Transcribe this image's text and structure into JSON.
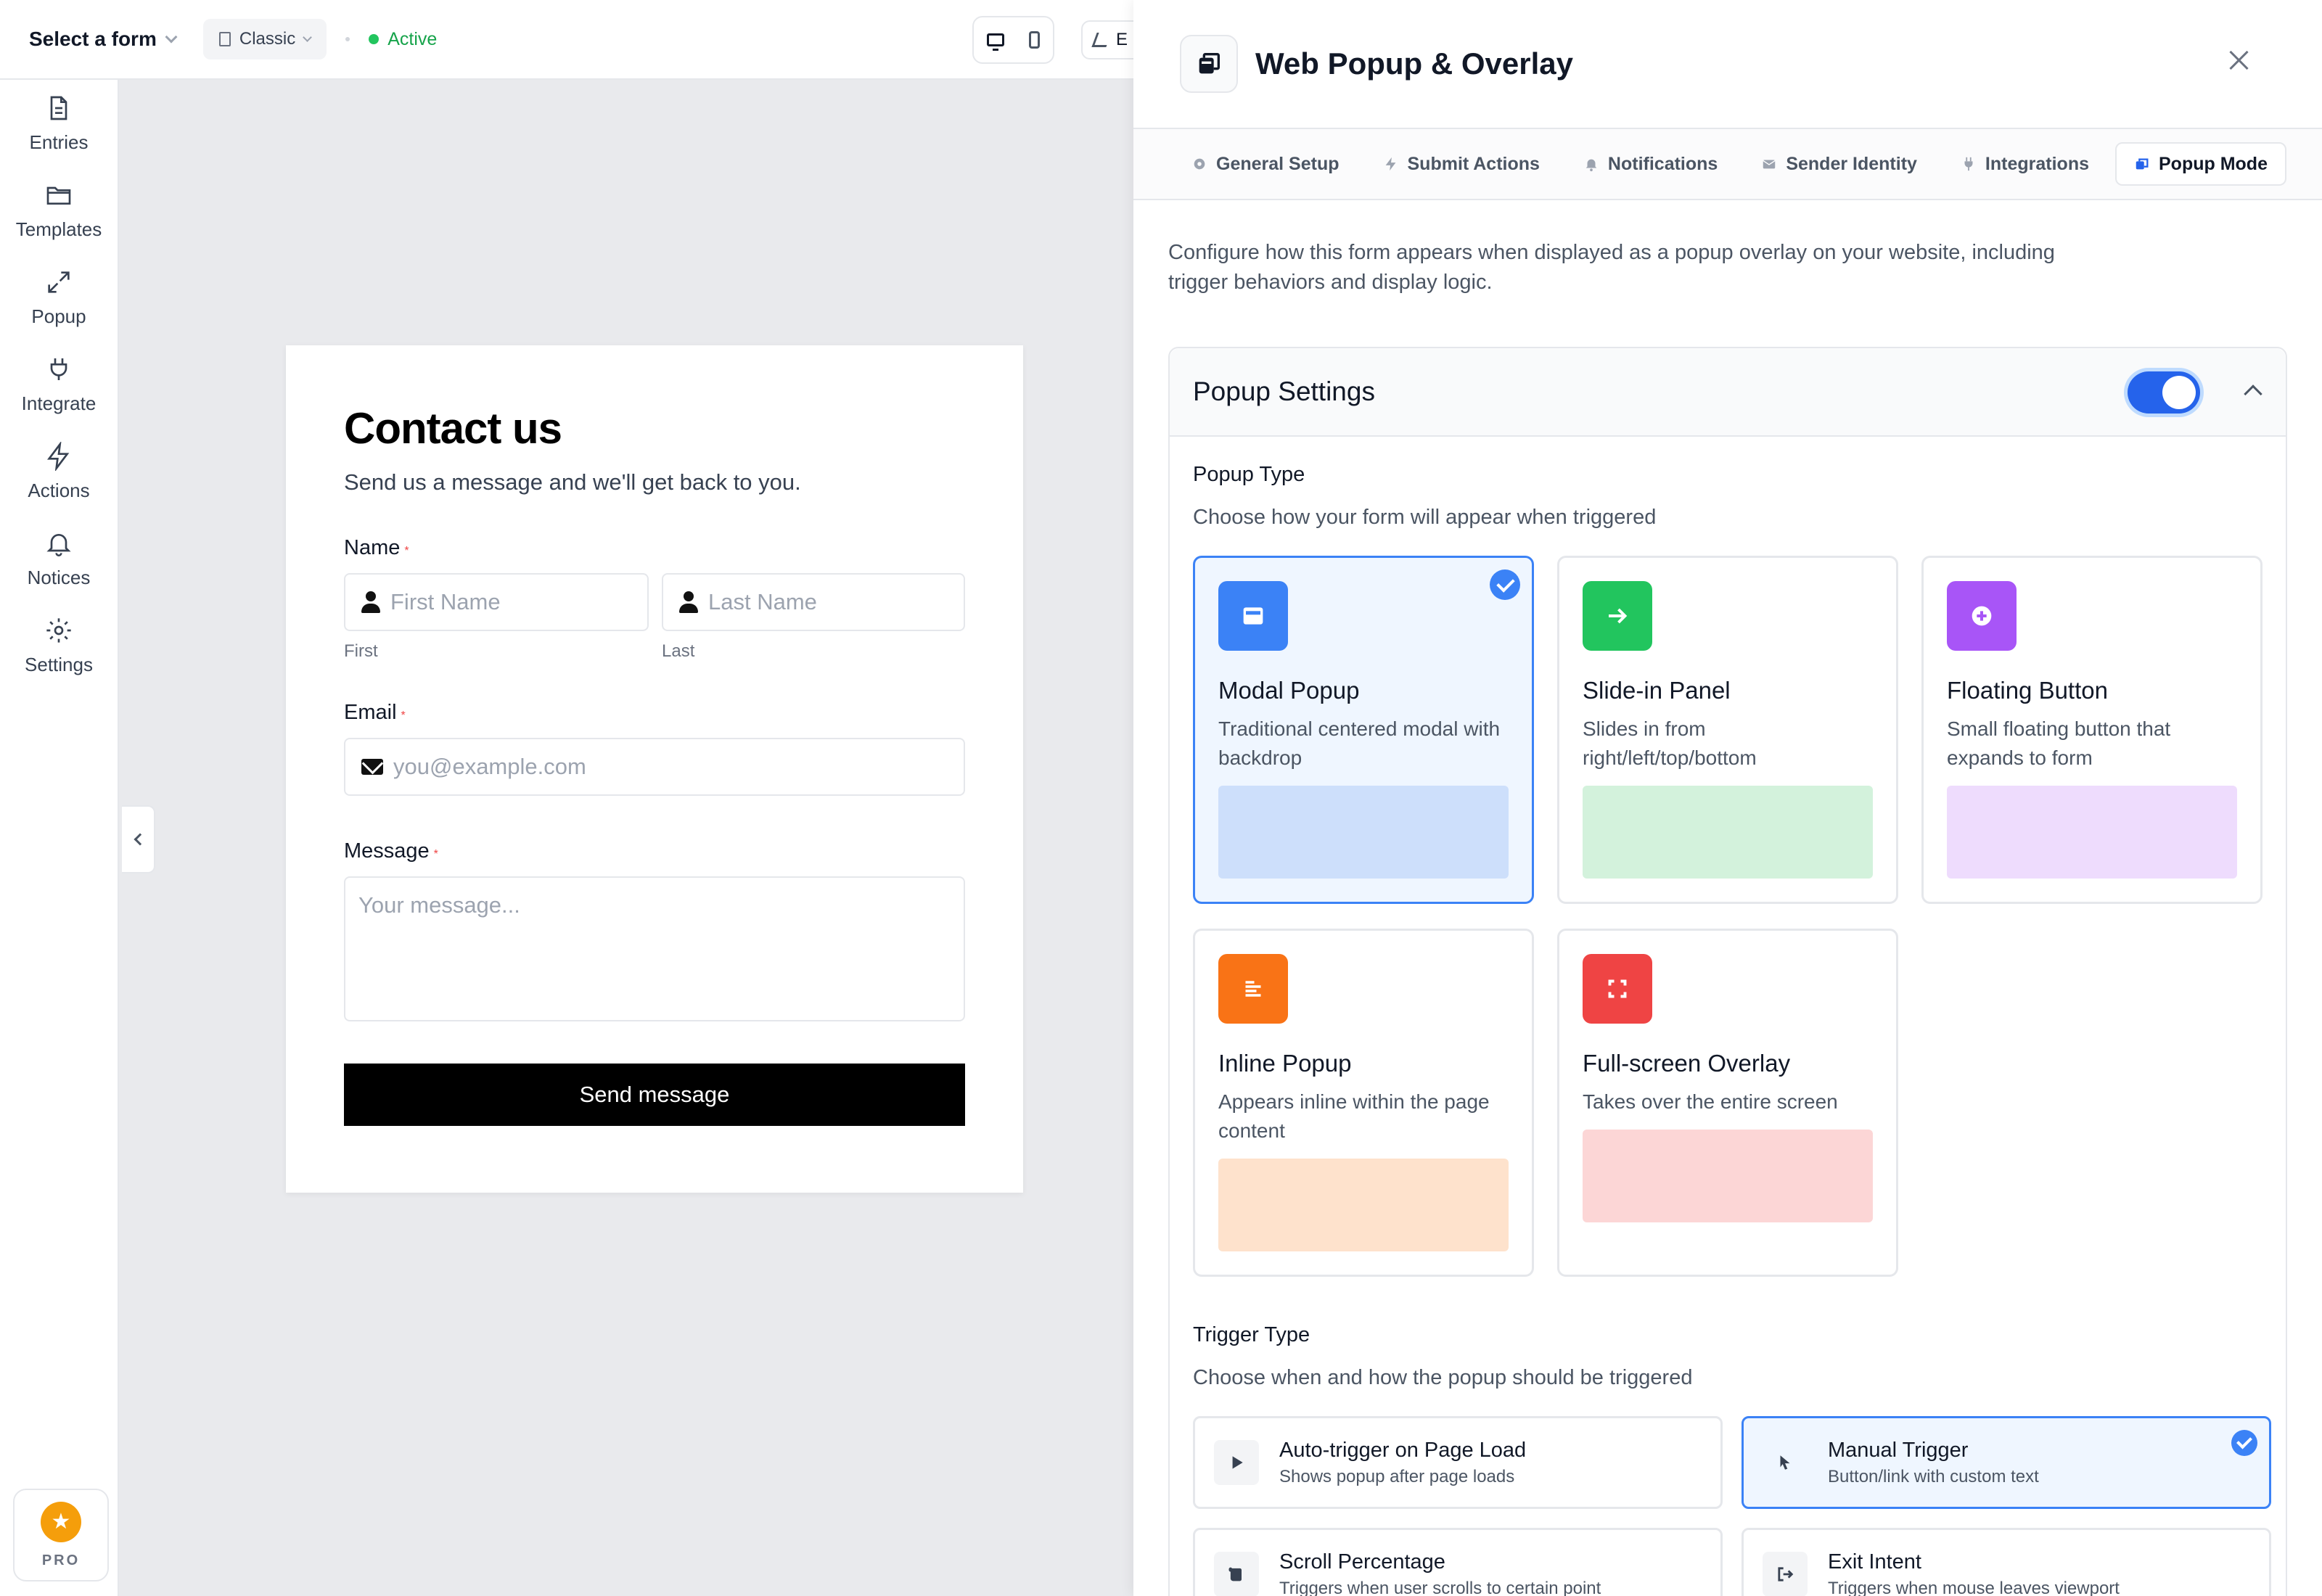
{
  "topbar": {
    "form_select": "Select a form",
    "layout": "Classic",
    "status": "Active",
    "edit_label": "E"
  },
  "sidebar": {
    "items": [
      {
        "label": "Entries",
        "icon": "document-icon"
      },
      {
        "label": "Templates",
        "icon": "folder-icon"
      },
      {
        "label": "Popup",
        "icon": "expand-icon"
      },
      {
        "label": "Integrate",
        "icon": "plug-icon"
      },
      {
        "label": "Actions",
        "icon": "bolt-icon"
      },
      {
        "label": "Notices",
        "icon": "bell-icon"
      },
      {
        "label": "Settings",
        "icon": "gear-icon"
      }
    ],
    "pro_label": "PRO"
  },
  "form": {
    "title": "Contact us",
    "subtitle": "Send us a message and we'll get back to you.",
    "name_label": "Name",
    "first_placeholder": "First Name",
    "last_placeholder": "Last Name",
    "first_hint": "First",
    "last_hint": "Last",
    "email_label": "Email",
    "email_placeholder": "you@example.com",
    "message_label": "Message",
    "message_placeholder": "Your message...",
    "required_mark": "*",
    "submit": "Send message"
  },
  "drawer": {
    "title": "Web Popup & Overlay",
    "tabs": [
      {
        "label": "General Setup"
      },
      {
        "label": "Submit Actions"
      },
      {
        "label": "Notifications"
      },
      {
        "label": "Sender Identity"
      },
      {
        "label": "Integrations"
      },
      {
        "label": "Popup Mode"
      }
    ],
    "intro": "Configure how this form appears when displayed as a popup overlay on your website, including trigger behaviors and display logic.",
    "settings_title": "Popup Settings",
    "popup_type_label": "Popup Type",
    "popup_type_desc": "Choose how your form will appear when triggered",
    "popup_types": [
      {
        "title": "Modal Popup",
        "desc": "Traditional centered modal with backdrop",
        "color": "#3b82f6",
        "preview": "#cddffb",
        "selected": true
      },
      {
        "title": "Slide-in Panel",
        "desc": "Slides in from right/left/top/bottom",
        "color": "#22c55e",
        "preview": "#d3f2dc",
        "selected": false
      },
      {
        "title": "Floating Button",
        "desc": "Small floating button that expands to form",
        "color": "#a855f7",
        "preview": "#eedcfd",
        "selected": false
      },
      {
        "title": "Inline Popup",
        "desc": "Appears inline within the page content",
        "color": "#f97316",
        "preview": "#fee2cc",
        "selected": false
      },
      {
        "title": "Full-screen Overlay",
        "desc": "Takes over the entire screen",
        "color": "#ef4444",
        "preview": "#fcd6d6",
        "selected": false
      }
    ],
    "trigger_type_label": "Trigger Type",
    "trigger_type_desc": "Choose when and how the popup should be triggered",
    "triggers": [
      {
        "title": "Auto-trigger on Page Load",
        "desc": "Shows popup after page loads",
        "selected": false
      },
      {
        "title": "Manual Trigger",
        "desc": "Button/link with custom text",
        "selected": true
      },
      {
        "title": "Scroll Percentage",
        "desc": "Triggers when user scrolls to certain point",
        "selected": false
      },
      {
        "title": "Exit Intent",
        "desc": "Triggers when mouse leaves viewport",
        "selected": false
      }
    ]
  }
}
